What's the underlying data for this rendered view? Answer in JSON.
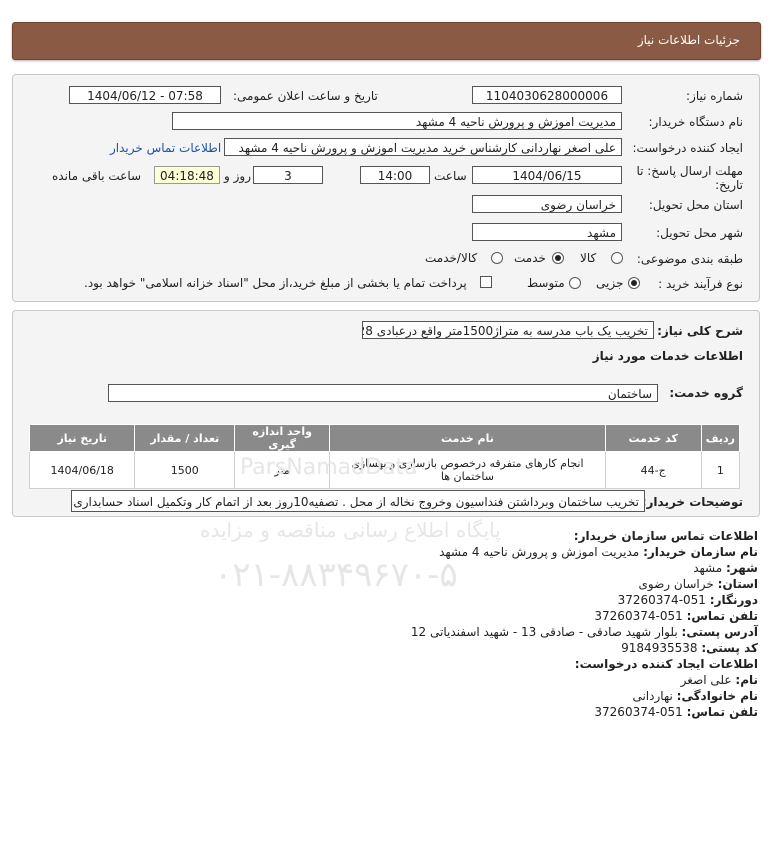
{
  "header": {
    "title": "جزئیات اطلاعات نیاز"
  },
  "form": {
    "need_number_label": "شماره نیاز:",
    "need_number": "1104030628000006",
    "announce_label": "تاریخ و ساعت اعلان عمومی:",
    "announce_value": "1404/06/12 - 07:58",
    "buyer_org_label": "نام دستگاه خریدار:",
    "buyer_org": "مدیریت اموزش و پرورش ناحیه 4 مشهد",
    "creator_label": "ایجاد کننده درخواست:",
    "creator": "علی اصغر نهاردانی کارشناس خرید  مدیریت اموزش و پرورش ناحیه 4 مشهد",
    "contact_link": "اطلاعات تماس خریدار",
    "deadline_label_1": "مهلت ارسال پاسخ: تا",
    "deadline_label_2": "تاریخ:",
    "deadline_date": "1404/06/15",
    "time_label": "ساعت",
    "deadline_time": "14:00",
    "days_value": "3",
    "days_label": "روز و",
    "remaining_time": "04:18:48",
    "remaining_label": "ساعت باقی مانده",
    "province_label": "استان محل تحویل:",
    "province": "خراسان رضوی",
    "city_label": "شهر محل تحویل:",
    "city": "مشهد",
    "category_label": "طبقه بندی موضوعی:",
    "category_options": [
      "کالا",
      "خدمت",
      "کالا/خدمت"
    ],
    "category_selected": "خدمت",
    "process_label": "نوع فرآیند خرید :",
    "process_options": [
      "جزیی",
      "متوسط"
    ],
    "process_selected": "جزیی",
    "payment_note": "پرداخت تمام یا بخشی از مبلغ خرید،از محل \"اسناد خزانه اسلامی\" خواهد بود."
  },
  "summary": {
    "general_label": "شرح کلی نیاز:",
    "general_value": "تخریب یک باب مدرسه به متراژ1500متر واقع درعبادی 28",
    "services_title": "اطلاعات خدمات مورد نیاز",
    "group_label": "گروه خدمت:",
    "group_value": "ساختمان",
    "table": {
      "headers": [
        "ردیف",
        "کد خدمت",
        "نام خدمت",
        "واحد اندازه گیری",
        "تعداد / مقدار",
        "تاریخ نیاز"
      ],
      "rows": [
        [
          "1",
          "ج-44",
          "انجام کارهای متفرقه درخصوص بازسازی و بهسازی ساختمان ها",
          "متر",
          "1500",
          "1404/06/18"
        ]
      ]
    },
    "buyer_desc_label": "توضیحات خریدار:",
    "buyer_desc": "تخریب ساختمان وبرداشتن فنداسیون وخروج نخاله از محل . تصفیه10روز بعد از اتمام کار وتکمیل اسناد حسابداری"
  },
  "contact": {
    "title": "اطلاعات تماس سازمان خریدار:",
    "org_label": "نام سازمان خریدار:",
    "org": "مدیریت اموزش و پرورش ناحیه 4 مشهد",
    "city_label": "شهر:",
    "city": "مشهد",
    "province_label": "استان:",
    "province": "خراسان رضوی",
    "fax_label": "دورنگار:",
    "fax": "051-37260374",
    "phone_label": "تلفن تماس:",
    "phone": "051-37260374",
    "address_label": "آدرس پستی:",
    "address": "بلوار شهید صادقی - صادقی 13 - شهید اسفندیاتی 12",
    "postal_label": "کد پستی:",
    "postal": "9184935538",
    "creator_title": "اطلاعات ایجاد کننده درخواست:",
    "name_label": "نام:",
    "name": "علی اصغر",
    "family_label": "نام خانوادگی:",
    "family": "نهاردانی",
    "creator_phone_label": "تلفن تماس:",
    "creator_phone": "051-37260374"
  },
  "watermark": {
    "line1": "پایگاه اطلاع رسانی مناقصه و مزایده",
    "line2": "۰۲۱-۸۸۳۴۹۶۷۰-۵",
    "brand": "ParsNamadData"
  }
}
